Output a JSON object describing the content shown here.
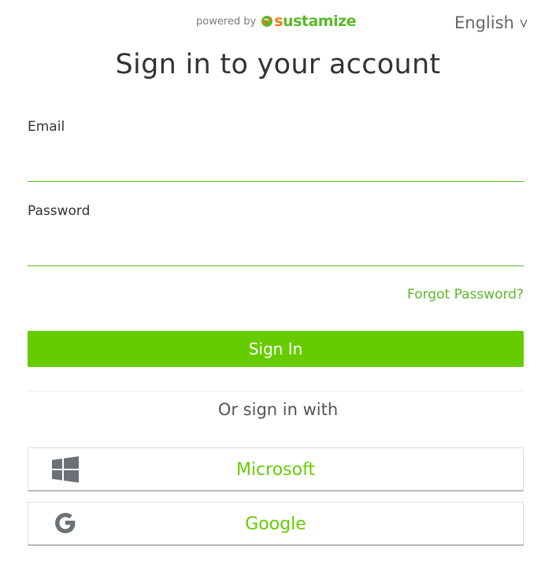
{
  "header": {
    "powered_by": "powered by",
    "brand_initial": "s",
    "brand_rest": "ustamize",
    "language": "English",
    "language_chevron": "v"
  },
  "title": "Sign in to your account",
  "form": {
    "email_label": "Email",
    "email_value": "",
    "password_label": "Password",
    "password_value": "",
    "forgot_password": "Forgot Password?",
    "submit_label": "Sign In"
  },
  "social": {
    "heading": "Or sign in with",
    "providers": [
      {
        "label": "Microsoft",
        "icon": "windows-icon"
      },
      {
        "label": "Google",
        "icon": "google-icon"
      }
    ]
  },
  "colors": {
    "accent": "#66cc00",
    "link": "#5cb82a",
    "brand_orange": "#f07a1a",
    "icon_gray": "#6b7177"
  }
}
